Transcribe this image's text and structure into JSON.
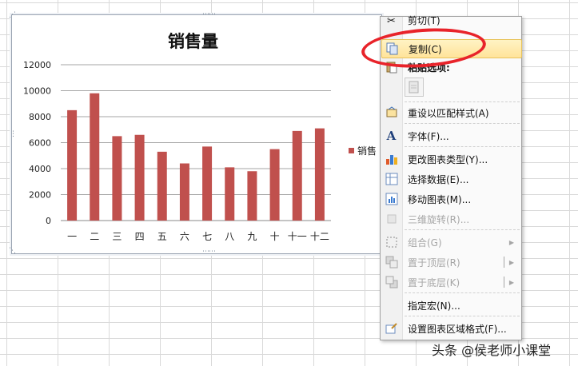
{
  "chart": {
    "title": "销售量",
    "legend_label": "销售"
  },
  "chart_data": {
    "type": "bar",
    "title": "销售量",
    "categories": [
      "一",
      "二",
      "三",
      "四",
      "五",
      "六",
      "七",
      "八",
      "九",
      "十",
      "十一",
      "十二"
    ],
    "series": [
      {
        "name": "销售",
        "values": [
          8500,
          9800,
          6500,
          6600,
          5300,
          4400,
          5700,
          4100,
          3800,
          5500,
          6900,
          7100
        ],
        "color": "#c0504d"
      }
    ],
    "yticks": [
      "0",
      "2000",
      "4000",
      "6000",
      "8000",
      "10000",
      "12000"
    ],
    "ylim": [
      0,
      12000
    ],
    "grid": true,
    "legend_position": "right"
  },
  "menu": {
    "top_partial": "剪切(T)",
    "copy": "复制(C)",
    "paste_options": "粘贴选项:",
    "reset_style": "重设以匹配样式(A)",
    "font": "字体(F)...",
    "change_type": "更改图表类型(Y)...",
    "select_data": "选择数据(E)...",
    "move_chart": "移动图表(M)...",
    "rotate3d": "三维旋转(R)...",
    "group": "组合(G)",
    "bring_front": "置于顶层(R)",
    "send_back": "置于底层(K)",
    "assign_macro": "指定宏(N)...",
    "format_area": "设置图表区域格式(F)..."
  },
  "watermark": "头条 @侯老师小课堂",
  "colors": {
    "bar": "#c0504d",
    "highlight": "#ffe39a",
    "oval": "#e8232a"
  }
}
